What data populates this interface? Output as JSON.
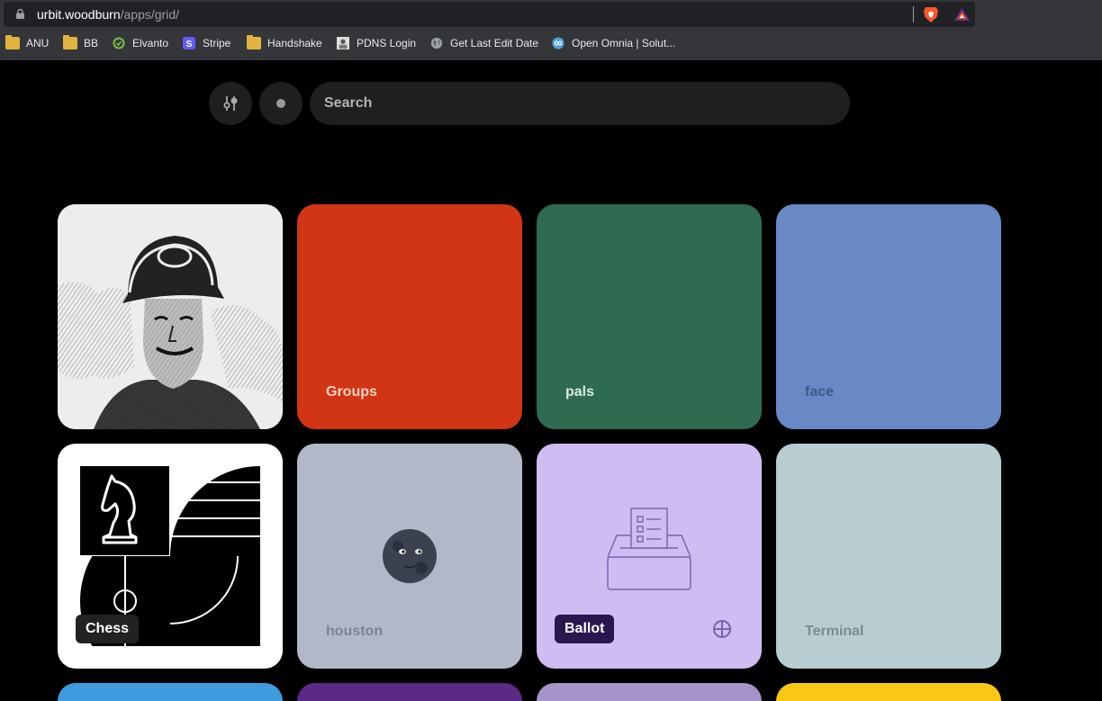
{
  "browser": {
    "url_host": "urbit.woodburn",
    "url_path": "/apps/grid/",
    "bookmarks": [
      {
        "label": "ANU",
        "icon": "folder-icon"
      },
      {
        "label": "BB",
        "icon": "folder-icon"
      },
      {
        "label": "Elvanto",
        "icon": "elvanto-icon"
      },
      {
        "label": "Stripe",
        "icon": "stripe-icon"
      },
      {
        "label": "Handshake",
        "icon": "folder-icon"
      },
      {
        "label": "PDNS Login",
        "icon": "pdns-icon"
      },
      {
        "label": "Get Last Edit Date",
        "icon": "globe-icon"
      },
      {
        "label": "Open Omnia | Solut...",
        "icon": "omnia-icon"
      }
    ]
  },
  "toolbar": {
    "search_placeholder": "Search"
  },
  "tiles": [
    {
      "label": "",
      "color": "#e9e9e9",
      "kind": "profile"
    },
    {
      "label": "Groups",
      "color": "#d13513",
      "text_color": "#f6d2c8"
    },
    {
      "label": "pals",
      "color": "#2e6b50",
      "text_color": "#d7eadf"
    },
    {
      "label": "face",
      "color": "#6888c6",
      "text_color": "#3f5a8c"
    },
    {
      "label": "Chess",
      "color": "#ffffff",
      "kind": "chess"
    },
    {
      "label": "houston",
      "color": "#b2b8c8",
      "text_color": "#7d8395"
    },
    {
      "label": "Ballot",
      "color": "#cfbcf2",
      "kind": "ballot"
    },
    {
      "label": "Terminal",
      "color": "#b8cdd1",
      "text_color": "#7c8c90"
    }
  ],
  "partial_tiles": [
    "#3e9bdd",
    "#5a2a86",
    "#a494c9",
    "#f8c815"
  ],
  "icons": {
    "filter": "sliders-icon",
    "notifications": "dot-icon",
    "houston": "new-moon-face-icon",
    "ballot_badge": "globe-badge-icon"
  }
}
